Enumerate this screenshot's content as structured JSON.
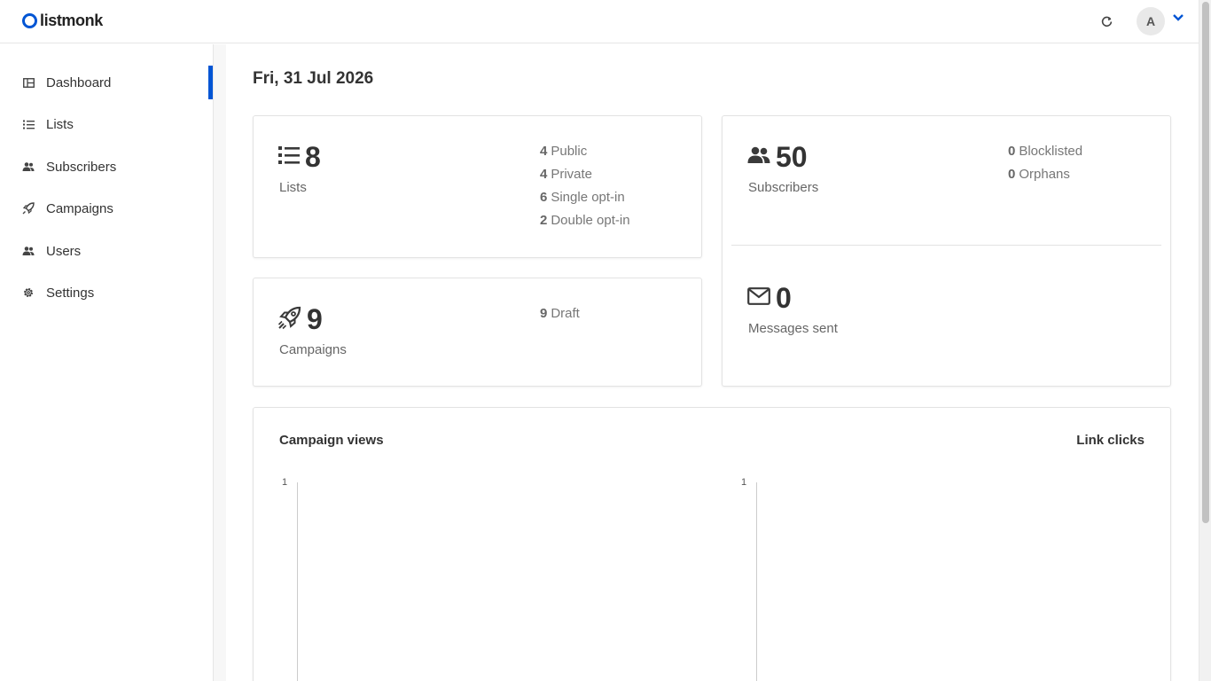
{
  "app": {
    "logo_text": "listmonk",
    "brand_color": "#0055d4",
    "avatar_initial": "A"
  },
  "sidebar": {
    "items": [
      {
        "label": "Dashboard",
        "icon": "dashboard-icon",
        "active": true
      },
      {
        "label": "Lists",
        "icon": "list-icon",
        "active": false
      },
      {
        "label": "Subscribers",
        "icon": "users-icon",
        "active": false
      },
      {
        "label": "Campaigns",
        "icon": "rocket-icon",
        "active": false
      },
      {
        "label": "Users",
        "icon": "users-icon",
        "active": false
      },
      {
        "label": "Settings",
        "icon": "gear-icon",
        "active": false
      }
    ]
  },
  "main": {
    "date": "Fri, 31 Jul 2026",
    "lists_card": {
      "count": "8",
      "label": "Lists",
      "breakdown": [
        {
          "num": "4",
          "label": "Public"
        },
        {
          "num": "4",
          "label": "Private"
        },
        {
          "num": "6",
          "label": "Single opt-in"
        },
        {
          "num": "2",
          "label": "Double opt-in"
        }
      ]
    },
    "campaigns_card": {
      "count": "9",
      "label": "Campaigns",
      "breakdown": [
        {
          "num": "9",
          "label": "Draft"
        }
      ]
    },
    "subscribers_card": {
      "count": "50",
      "label": "Subscribers",
      "breakdown": [
        {
          "num": "0",
          "label": "Blocklisted"
        },
        {
          "num": "0",
          "label": "Orphans"
        }
      ]
    },
    "messages_card": {
      "count": "0",
      "label": "Messages sent"
    },
    "charts": {
      "views_title": "Campaign views",
      "clicks_title": "Link clicks",
      "views_y_tick": "1",
      "clicks_y_tick": "1"
    }
  },
  "chart_data": [
    {
      "type": "line",
      "title": "Campaign views",
      "yticks": [
        "1"
      ],
      "series": []
    },
    {
      "type": "line",
      "title": "Link clicks",
      "yticks": [
        "1"
      ],
      "series": []
    }
  ]
}
